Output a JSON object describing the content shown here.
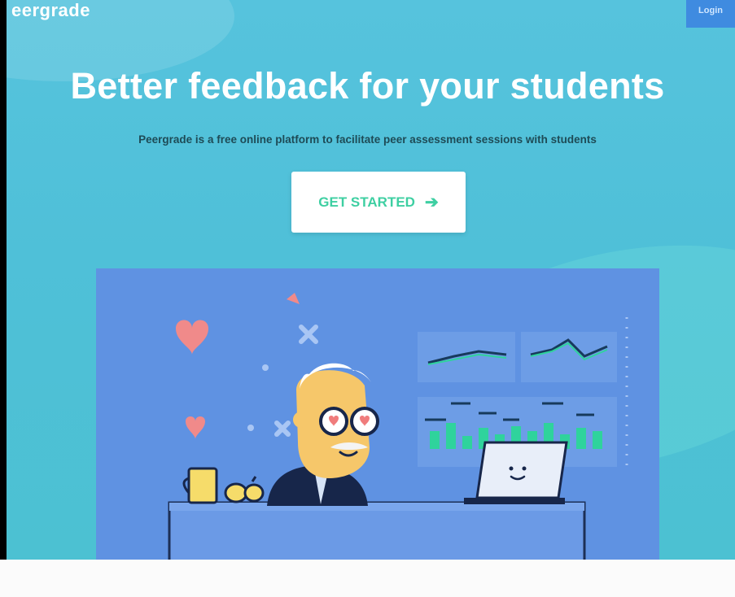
{
  "header": {
    "logo_text": "eergrade",
    "login_label": "Login"
  },
  "hero": {
    "title": "Better feedback for your students",
    "subtitle": "Peergrade is a free online platform to facilitate peer assessment sessions with students",
    "cta_label": "GET STARTED",
    "cta_arrow": "➔"
  },
  "colors": {
    "hero_bg": "#55c3dc",
    "cta_text": "#3ecfa2",
    "illustration_bg": "#5b8fe0",
    "login_bg": "#3f8be0"
  },
  "icons": [
    "arrow-right-icon"
  ]
}
